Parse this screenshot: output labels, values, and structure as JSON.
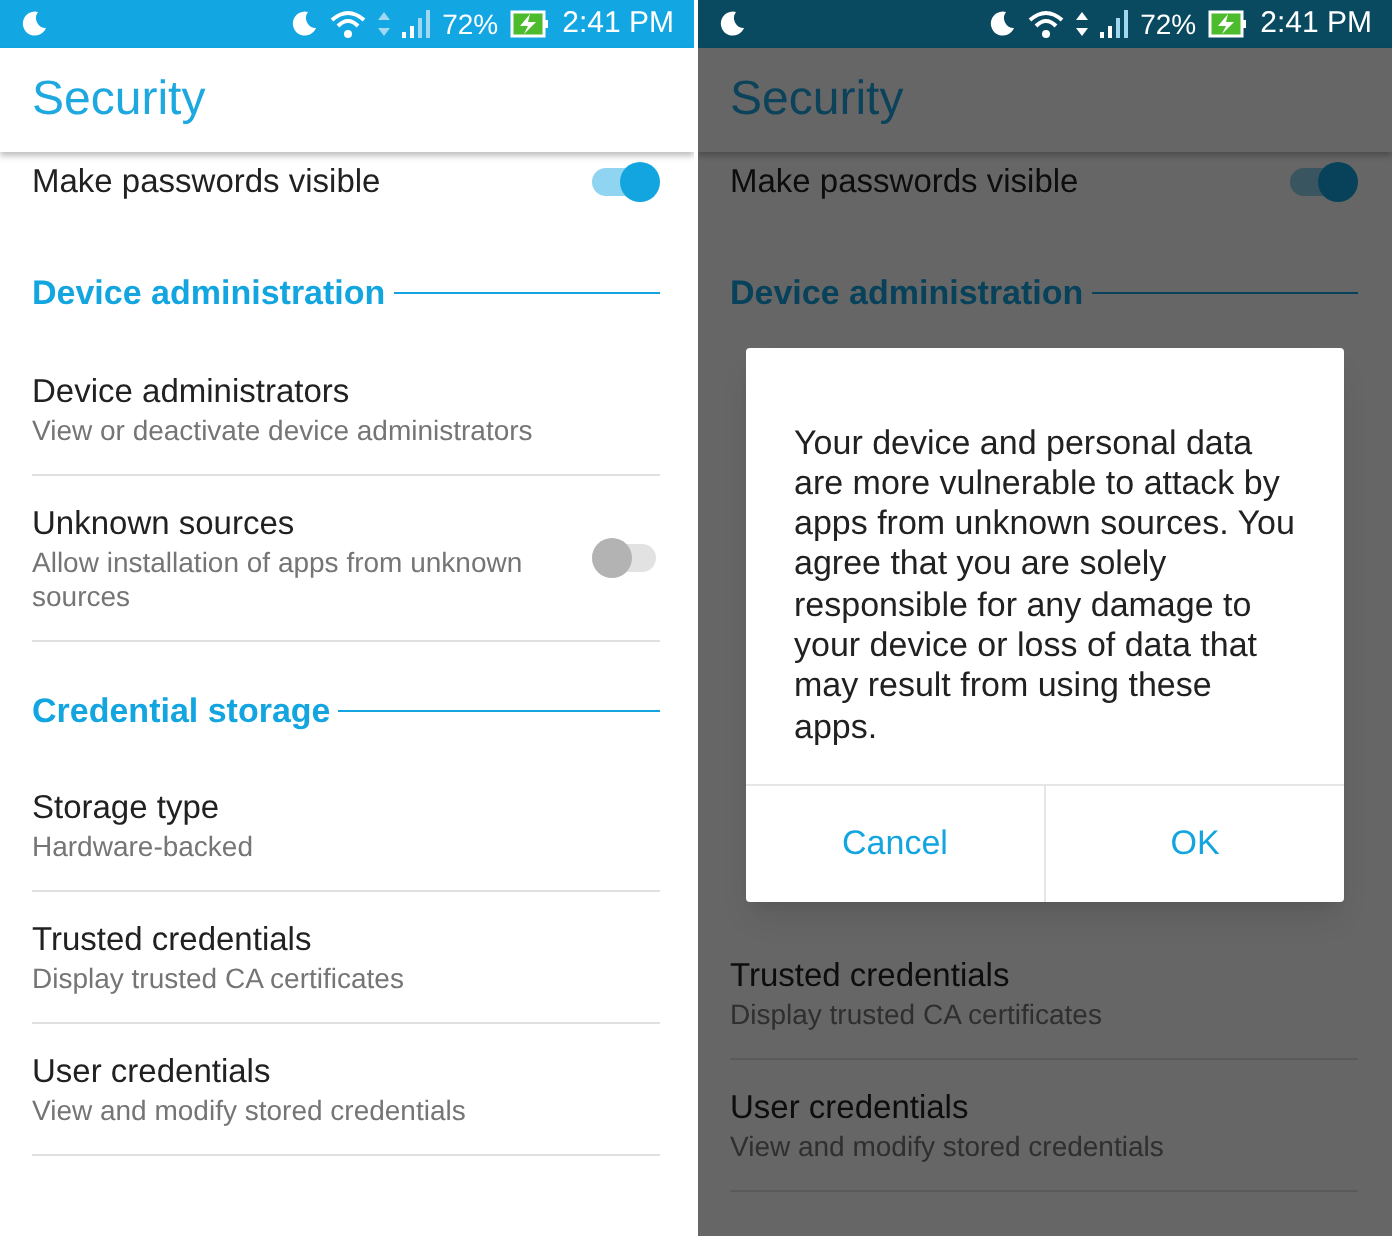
{
  "screens": [
    {
      "dimmed": false,
      "status_bar": {
        "battery": "72%",
        "time": "2:41 PM"
      },
      "title": "Security",
      "items": [
        {
          "kind": "toggle",
          "title": "Make passwords visible",
          "on": true
        },
        {
          "kind": "header",
          "label": "Device administration"
        },
        {
          "kind": "item",
          "title": "Device administrators",
          "subtitle": "View or deactivate device administrators"
        },
        {
          "kind": "toggle",
          "title": "Unknown sources",
          "subtitle": "Allow installation of apps from unknown sources",
          "on": false
        },
        {
          "kind": "header",
          "label": "Credential storage"
        },
        {
          "kind": "item",
          "title": "Storage type",
          "subtitle": "Hardware-backed"
        },
        {
          "kind": "item",
          "title": "Trusted credentials",
          "subtitle": "Display trusted CA certificates"
        },
        {
          "kind": "item",
          "title": "User credentials",
          "subtitle": "View and modify stored credentials"
        }
      ]
    },
    {
      "dimmed": true,
      "status_bar": {
        "battery": "72%",
        "time": "2:41 PM"
      },
      "title": "Security",
      "items": [
        {
          "kind": "toggle",
          "title": "Make passwords visible",
          "on": true
        },
        {
          "kind": "header",
          "label": "Device administration"
        },
        {
          "kind": "dialog",
          "message": "Your device and personal data are more vulnerable to attack by apps from unknown sources. You agree that you are solely responsible for any damage to your device or loss of data that may result from using these apps.",
          "buttons": [
            "Cancel",
            "OK"
          ]
        },
        {
          "kind": "item",
          "title": "Trusted credentials",
          "subtitle": "Display trusted CA certificates"
        },
        {
          "kind": "item",
          "title": "User credentials",
          "subtitle": "View and modify stored credentials"
        }
      ]
    }
  ]
}
